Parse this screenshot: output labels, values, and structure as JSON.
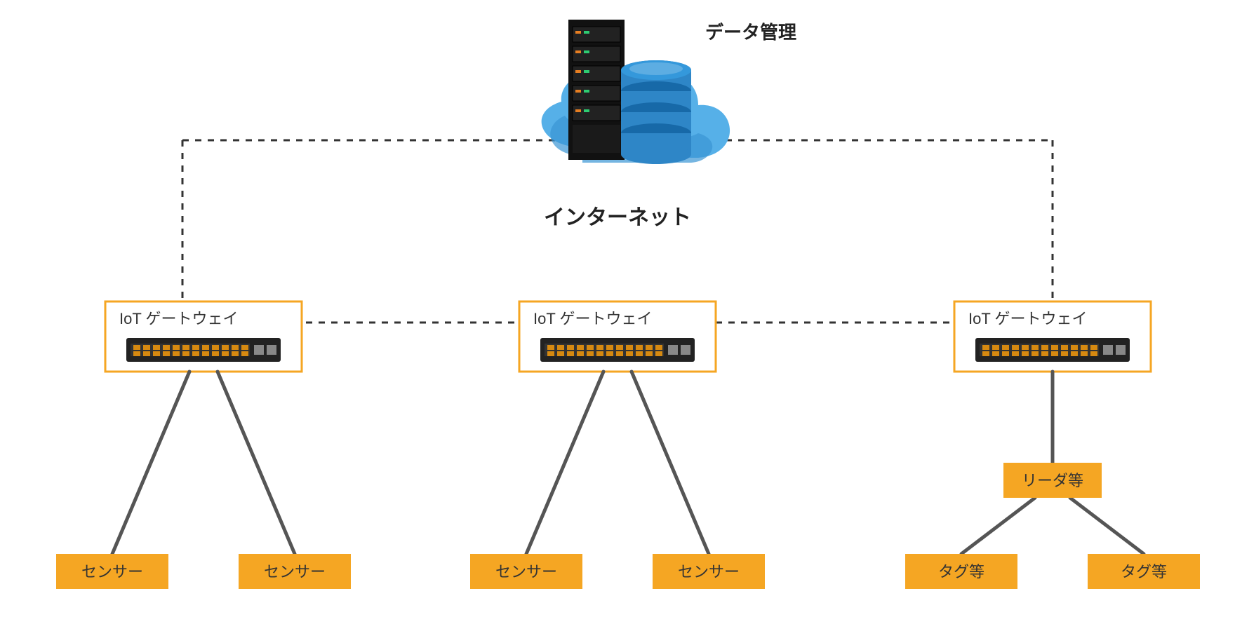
{
  "top_label": "データ管理",
  "internet_label": "インターネット",
  "gateways": [
    "IoT ゲートウェイ",
    "IoT ゲートウェイ",
    "IoT ゲートウェイ"
  ],
  "reader_label": "リーダ等",
  "leaves": [
    "センサー",
    "センサー",
    "センサー",
    "センサー",
    "タグ等",
    "タグ等"
  ],
  "colors": {
    "accent": "#f5a623",
    "cloud": "#3aa0e0",
    "cloud_dark": "#1f6fa8",
    "server": "#1a1a1a",
    "db": "#2e86c7",
    "line": "#555"
  }
}
